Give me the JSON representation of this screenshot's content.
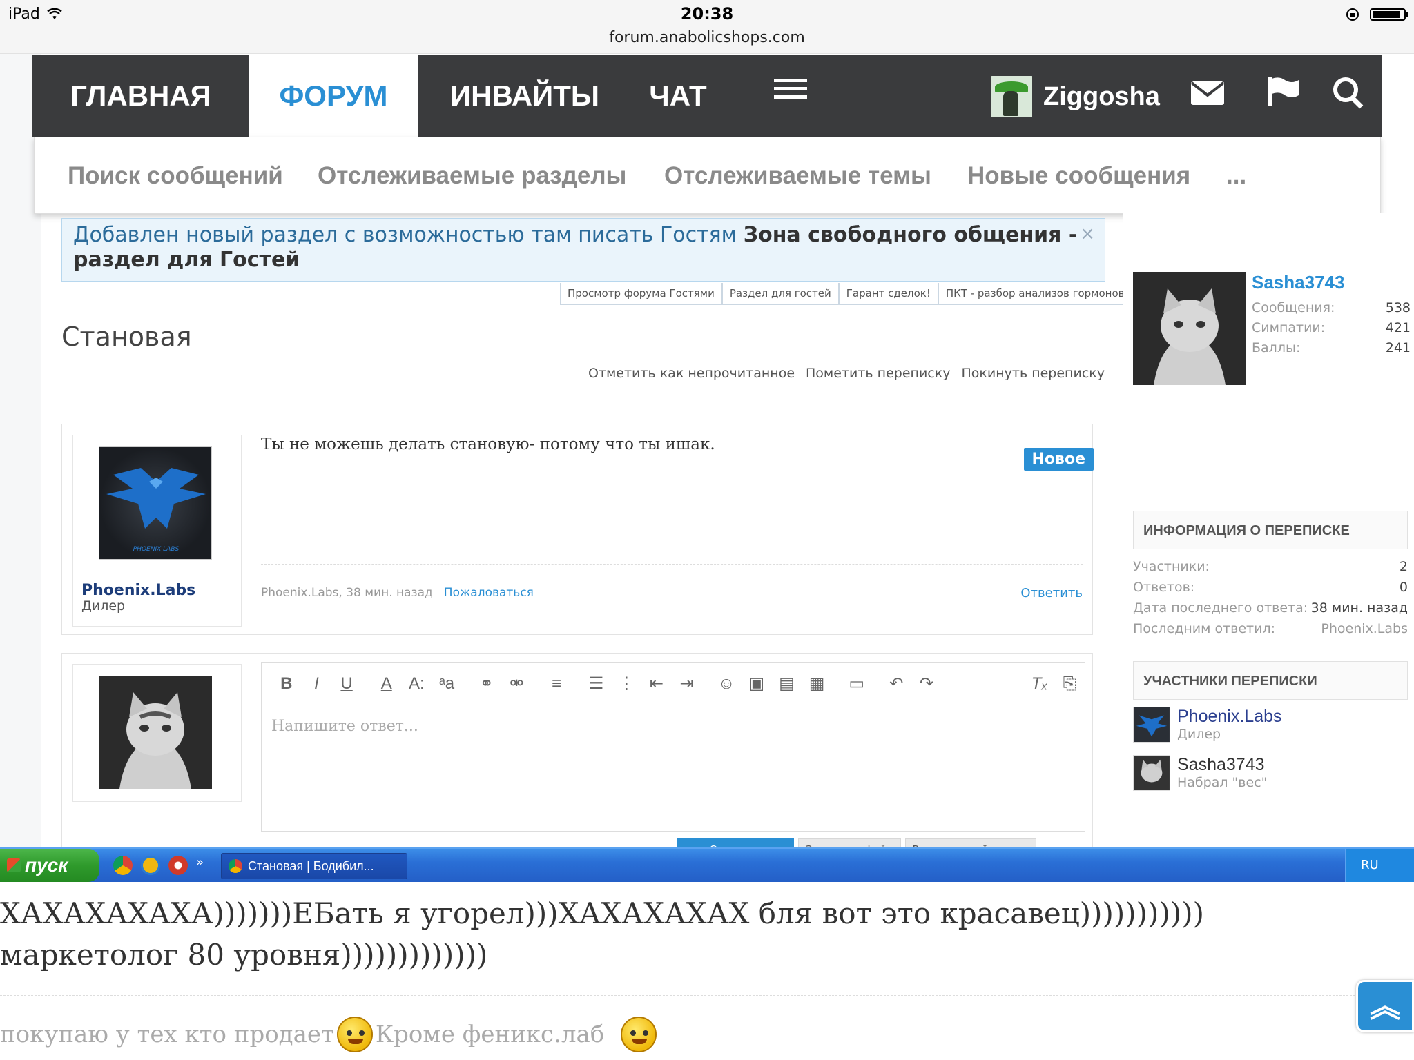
{
  "status_bar": {
    "device": "iPad",
    "time": "20:38",
    "url": "forum.anabolicshops.com"
  },
  "nav": {
    "items": [
      "ГЛАВНАЯ",
      "ФОРУМ",
      "ИНВАЙТЫ",
      "ЧАТ"
    ],
    "active": "ФОРУМ",
    "username": "Ziggosha",
    "icons": [
      "menu-icon",
      "mail-icon",
      "flag-icon",
      "search-icon"
    ]
  },
  "subnav": {
    "items": [
      "Поиск сообщений",
      "Отслеживаемые разделы",
      "Отслеживаемые темы",
      "Новые сообщения",
      "..."
    ]
  },
  "notice": {
    "text": "Добавлен новый раздел с возможностью там писать Гостям ",
    "bold": "Зона свободного общения - раздел для Гостей",
    "close": "×",
    "tabs": [
      "Просмотр форума Гостями",
      "Раздел для гостей",
      "Гарант сделок!",
      "ПКТ - разбор анализов гормонов"
    ]
  },
  "thread": {
    "title": "Становая",
    "actions": [
      "Отметить как непрочитанное",
      "Пометить переписку",
      "Покинуть переписку"
    ]
  },
  "message": {
    "username": "Phoenix.Labs",
    "user_title": "Дилер",
    "avatar_text": "PHOENIX LABS",
    "text": "Ты не можешь делать становую- потому что ты ишак.",
    "badge": "Новое",
    "meta": "Phoenix.Labs, 38 мин. назад",
    "report": "Пожаловаться",
    "reply": "Ответить"
  },
  "reply_box": {
    "placeholder": "Напишите ответ...",
    "buttons": [
      "Ответить",
      "Загрузить файл",
      "Расширенный режим"
    ],
    "toolbar": [
      "B",
      "I",
      "U",
      "A",
      "A:",
      "ᵃa",
      "link-icon",
      "unlink-icon",
      "align-icon",
      "bullet-list-icon",
      "numbered-list-icon",
      "outdent-icon",
      "indent-icon",
      "smiley-icon",
      "image-icon",
      "media-icon",
      "quote-icon",
      "save-icon",
      "undo-icon",
      "redo-icon",
      "clear-format-icon",
      "bbcode-icon"
    ]
  },
  "sidebar": {
    "profile": {
      "name": "Sasha3743",
      "stats": [
        {
          "label": "Сообщения:",
          "value": "538"
        },
        {
          "label": "Симпатии:",
          "value": "421"
        },
        {
          "label": "Баллы:",
          "value": "241"
        }
      ]
    },
    "info_title": "ИНФОРМАЦИЯ О ПЕРЕПИСКЕ",
    "info": [
      {
        "label": "Участники:",
        "value": "2"
      },
      {
        "label": "Ответов:",
        "value": "0"
      },
      {
        "label": "Дата последнего ответа:",
        "value": "38 мин. назад"
      },
      {
        "label": "Последним ответил:",
        "value": "Phoenix.Labs"
      }
    ],
    "participants_title": "УЧАСТНИКИ ПЕРЕПИСКИ",
    "participants": [
      {
        "name": "Phoenix.Labs",
        "title": "Дилер"
      },
      {
        "name": "Sasha3743",
        "title": "Набрал \"вес\""
      }
    ]
  },
  "taskbar": {
    "start": "пуск",
    "task": "Становая | Бодибил...",
    "lang": "RU",
    "chevrons": "»"
  },
  "lower": {
    "line1": "ХАХАХАХАХА)))))))ЕБать я угорел)))ХАХАХАХАХ бля вот это красавец)))))))))))",
    "line2": "маркетолог 80 уровня)))))))))))))",
    "line3a": "покупаю у тех кто продает",
    "line3b": "Кроме феникс.лаб"
  },
  "colors": {
    "accent": "#2a8fd4",
    "nav_bg": "#3a3b3d",
    "taskbar": "#245fc7"
  }
}
